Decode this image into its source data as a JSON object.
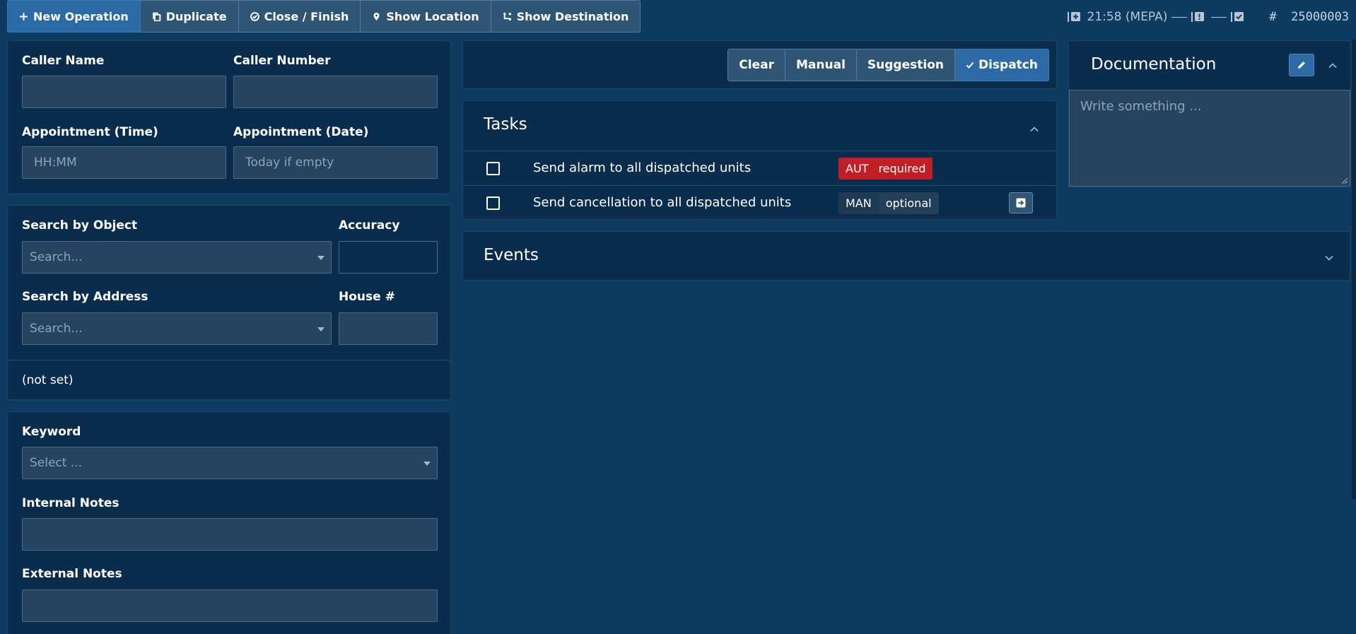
{
  "toolbar": {
    "new_operation": "New Operation",
    "duplicate": "Duplicate",
    "close_finish": "Close / Finish",
    "show_location": "Show Location",
    "show_destination": "Show Destination"
  },
  "status": {
    "time": "21:58 (MEPA)",
    "hash": "#",
    "operation_number": "25000003"
  },
  "caller": {
    "name_label": "Caller Name",
    "number_label": "Caller Number",
    "time_label": "Appointment (Time)",
    "time_placeholder": "HH:MM",
    "date_label": "Appointment (Date)",
    "date_placeholder": "Today if empty"
  },
  "location": {
    "object_label": "Search by Object",
    "object_placeholder": "Search...",
    "accuracy_label": "Accuracy",
    "address_label": "Search by Address",
    "address_placeholder": "Search...",
    "house_label": "House #",
    "resolved": "(not set)"
  },
  "details": {
    "keyword_label": "Keyword",
    "keyword_placeholder": "Select ...",
    "internal_label": "Internal Notes",
    "external_label": "External Notes"
  },
  "dispatch_mode": {
    "clear": "Clear",
    "manual": "Manual",
    "suggestion": "Suggestion",
    "dispatch": "Dispatch",
    "active": "Dispatch"
  },
  "tasks": {
    "title": "Tasks",
    "items": [
      {
        "text": "Send alarm to all dispatched units",
        "mode": "AUT",
        "requirement": "required",
        "checked": false
      },
      {
        "text": "Send cancellation to all dispatched units",
        "mode": "MAN",
        "requirement": "optional",
        "checked": false
      }
    ]
  },
  "events": {
    "title": "Events"
  },
  "documentation": {
    "title": "Documentation",
    "placeholder": "Write something ..."
  },
  "colors": {
    "background": "#0d3b62",
    "panel": "#0b2d4d",
    "primary": "#2c6aa6",
    "required_badge": "#c21e26"
  }
}
